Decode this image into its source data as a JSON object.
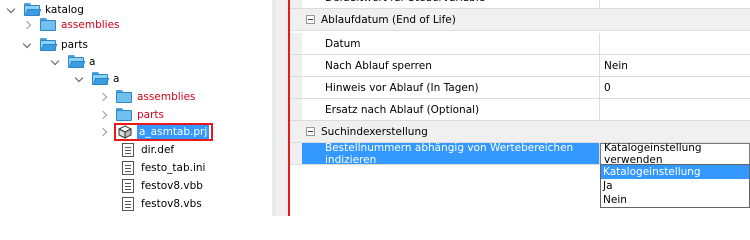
{
  "tree": {
    "items": [
      {
        "label": "katalog"
      },
      {
        "label": "assemblies"
      },
      {
        "label": "parts"
      },
      {
        "label": "a"
      },
      {
        "label": "a"
      },
      {
        "label": "assemblies"
      },
      {
        "label": "parts"
      },
      {
        "label": "a_asmtab.prj"
      },
      {
        "label": "dir.def"
      },
      {
        "label": "festo_tab.ini"
      },
      {
        "label": "festov8.vbb"
      },
      {
        "label": "festov8.vbs"
      }
    ]
  },
  "grid": {
    "top_cut_label": "Defaultwert für Steuervariable",
    "rows": [
      {
        "name": "Ablaufdatum (End of Life)",
        "value": ""
      },
      {
        "name": "Datum",
        "value": ""
      },
      {
        "name": "Nach Ablauf sperren",
        "value": "Nein"
      },
      {
        "name": "Hinweis vor Ablauf (In Tagen)",
        "value": "0"
      },
      {
        "name": "Ersatz nach Ablauf (Optional)",
        "value": ""
      },
      {
        "name": "Suchindexerstellung",
        "value": ""
      },
      {
        "name": "Bestellnummern abhängig von Wertebereichen indizieren",
        "value": "Katalogeinstellung verwenden"
      }
    ],
    "dropdown_options": [
      "Katalogeinstellung verwenden",
      "Ja",
      "Nein"
    ],
    "dropdown_selected": "Katalogeinstellung verwenden"
  },
  "colors": {
    "selection": "#3399ff",
    "highlight_red": "#e8191b",
    "folder_label_red": "#d0021b"
  }
}
